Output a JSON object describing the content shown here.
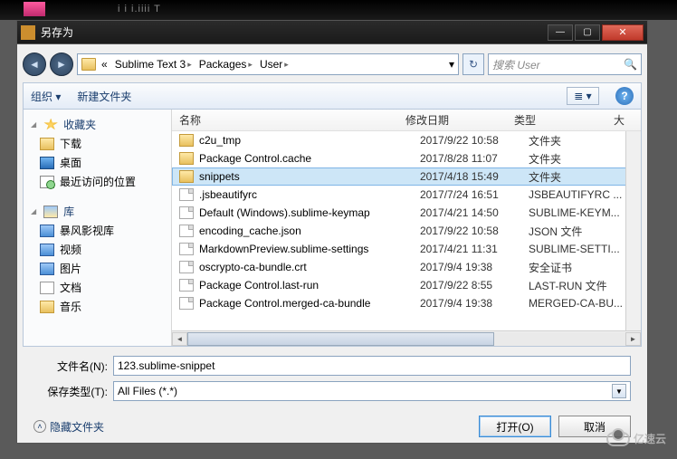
{
  "window": {
    "title": "另存为"
  },
  "breadcrumbs": [
    "Sublime Text 3",
    "Packages",
    "User"
  ],
  "search": {
    "placeholder": "搜索 User"
  },
  "toolbar": {
    "organize": "组织 ▾",
    "newfolder": "新建文件夹"
  },
  "columns": {
    "name": "名称",
    "modified": "修改日期",
    "type": "类型",
    "size": "大"
  },
  "sidebar": {
    "favorites": {
      "head": "收藏夹",
      "items": [
        "下载",
        "桌面",
        "最近访问的位置"
      ]
    },
    "libraries": {
      "head": "库",
      "items": [
        "暴风影视库",
        "视频",
        "图片",
        "文档",
        "音乐"
      ]
    }
  },
  "files": [
    {
      "name": "c2u_tmp",
      "date": "2017/9/22 10:58",
      "type": "文件夹",
      "kind": "folder",
      "sel": false
    },
    {
      "name": "Package Control.cache",
      "date": "2017/8/28 11:07",
      "type": "文件夹",
      "kind": "folder",
      "sel": false
    },
    {
      "name": "snippets",
      "date": "2017/4/18 15:49",
      "type": "文件夹",
      "kind": "folder",
      "sel": true
    },
    {
      "name": ".jsbeautifyrc",
      "date": "2017/7/24 16:51",
      "type": "JSBEAUTIFYRC ...",
      "kind": "file",
      "sel": false
    },
    {
      "name": "Default (Windows).sublime-keymap",
      "date": "2017/4/21 14:50",
      "type": "SUBLIME-KEYM...",
      "kind": "file",
      "sel": false
    },
    {
      "name": "encoding_cache.json",
      "date": "2017/9/22 10:58",
      "type": "JSON 文件",
      "kind": "file",
      "sel": false
    },
    {
      "name": "MarkdownPreview.sublime-settings",
      "date": "2017/4/21 11:31",
      "type": "SUBLIME-SETTI...",
      "kind": "file",
      "sel": false
    },
    {
      "name": "oscrypto-ca-bundle.crt",
      "date": "2017/9/4 19:38",
      "type": "安全证书",
      "kind": "file",
      "sel": false
    },
    {
      "name": "Package Control.last-run",
      "date": "2017/9/22 8:55",
      "type": "LAST-RUN 文件",
      "kind": "file",
      "sel": false
    },
    {
      "name": "Package Control.merged-ca-bundle",
      "date": "2017/9/4 19:38",
      "type": "MERGED-CA-BU...",
      "kind": "file",
      "sel": false
    }
  ],
  "filename": {
    "label": "文件名(N):",
    "value": "123.sublime-snippet"
  },
  "filetype": {
    "label": "保存类型(T):",
    "value": "All Files (*.*)"
  },
  "hidefolders": "隐藏文件夹",
  "buttons": {
    "open": "打开(O)",
    "cancel": "取消"
  },
  "watermark": "亿速云",
  "topedge_text": "i i i.iiii T"
}
